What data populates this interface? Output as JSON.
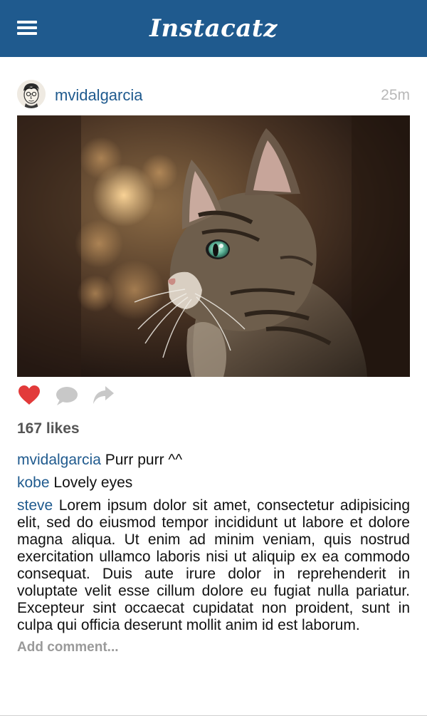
{
  "app": {
    "title": "Instacatz",
    "brand_color": "#1f5a8e"
  },
  "post": {
    "username": "mvidalgarcia",
    "timestamp": "25m",
    "likes_label": "167 likes",
    "liked": true,
    "icons": {
      "menu": "hamburger-menu-icon",
      "like": "heart-icon",
      "comment": "speech-bubble-icon",
      "share": "share-arrow-icon"
    },
    "comments": [
      {
        "user": "mvidalgarcia",
        "text": "Purr purr ^^"
      },
      {
        "user": "kobe",
        "text": "Lovely eyes"
      },
      {
        "user": "steve",
        "text": "Lorem ipsum dolor sit amet, consectetur adipisicing elit, sed do eiusmod tempor incididunt ut labore et dolore magna aliqua. Ut enim ad minim veniam, quis nostrud exercitation ullamco laboris nisi ut aliquip ex ea commodo consequat. Duis aute irure dolor in reprehenderit in voluptate velit esse cillum dolore eu fugiat nulla pariatur. Excepteur sint occaecat cupidatat non proident, sunt in culpa qui officia deserunt mollit anim id est laborum."
      }
    ],
    "add_comment_placeholder": "Add comment..."
  }
}
